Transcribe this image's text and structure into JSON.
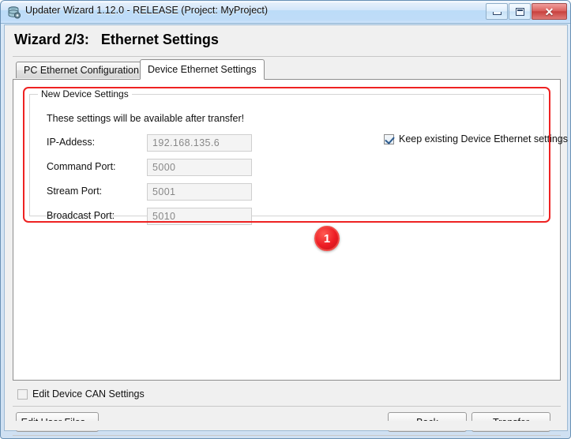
{
  "window": {
    "title": "Updater Wizard 1.12.0 - RELEASE (Project: MyProject)",
    "icon": "database-gear-icon",
    "buttons": {
      "minimize": "minimize-icon",
      "maximize": "maximize-icon",
      "close": "✕"
    }
  },
  "page": {
    "heading": "Wizard 2/3:   Ethernet Settings"
  },
  "tabs": [
    {
      "label": "PC Ethernet Configuration",
      "selected": false
    },
    {
      "label": "Device Ethernet Settings",
      "selected": true
    }
  ],
  "group": {
    "title": "New Device Settings",
    "hint": "These settings will be available after transfer!",
    "fields": [
      {
        "label": "IP-Addess:",
        "value": "192.168.135.6"
      },
      {
        "label": "Command  Port:",
        "value": "5000"
      },
      {
        "label": "Stream Port:",
        "value": "5001"
      },
      {
        "label": "Broadcast Port:",
        "value": "5010"
      }
    ],
    "keep_existing": {
      "label": "Keep existing Device Ethernet settings",
      "checked": true
    }
  },
  "annotation": {
    "step_badge": "1",
    "highlight_color": "#ee2222"
  },
  "can_settings": {
    "label": "Edit Device CAN Settings",
    "checked": false
  },
  "footer": {
    "edit_user_files": "Edit User Files...",
    "back": "Back",
    "transfer": "Transfer"
  }
}
